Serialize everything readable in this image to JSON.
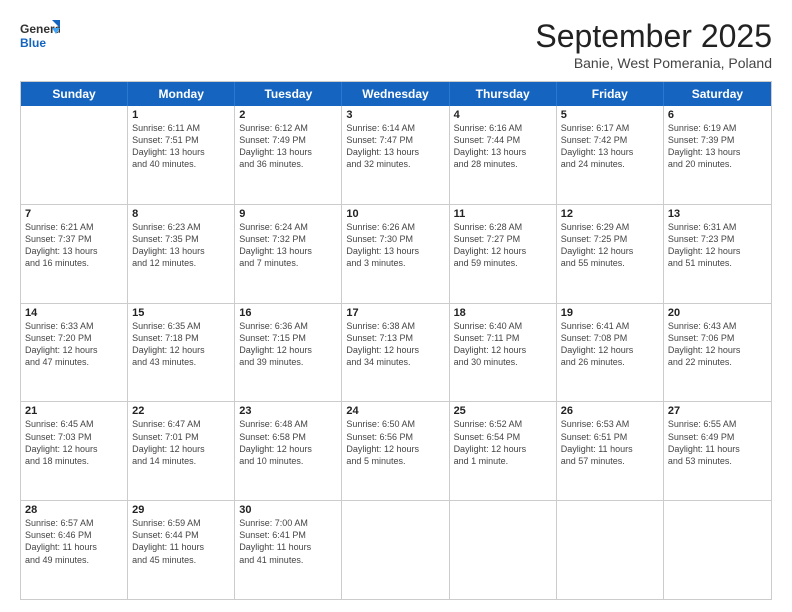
{
  "header": {
    "logo_general": "General",
    "logo_blue": "Blue",
    "month_title": "September 2025",
    "subtitle": "Banie, West Pomerania, Poland"
  },
  "days_of_week": [
    "Sunday",
    "Monday",
    "Tuesday",
    "Wednesday",
    "Thursday",
    "Friday",
    "Saturday"
  ],
  "weeks": [
    [
      {
        "day": "",
        "lines": []
      },
      {
        "day": "1",
        "lines": [
          "Sunrise: 6:11 AM",
          "Sunset: 7:51 PM",
          "Daylight: 13 hours",
          "and 40 minutes."
        ]
      },
      {
        "day": "2",
        "lines": [
          "Sunrise: 6:12 AM",
          "Sunset: 7:49 PM",
          "Daylight: 13 hours",
          "and 36 minutes."
        ]
      },
      {
        "day": "3",
        "lines": [
          "Sunrise: 6:14 AM",
          "Sunset: 7:47 PM",
          "Daylight: 13 hours",
          "and 32 minutes."
        ]
      },
      {
        "day": "4",
        "lines": [
          "Sunrise: 6:16 AM",
          "Sunset: 7:44 PM",
          "Daylight: 13 hours",
          "and 28 minutes."
        ]
      },
      {
        "day": "5",
        "lines": [
          "Sunrise: 6:17 AM",
          "Sunset: 7:42 PM",
          "Daylight: 13 hours",
          "and 24 minutes."
        ]
      },
      {
        "day": "6",
        "lines": [
          "Sunrise: 6:19 AM",
          "Sunset: 7:39 PM",
          "Daylight: 13 hours",
          "and 20 minutes."
        ]
      }
    ],
    [
      {
        "day": "7",
        "lines": [
          "Sunrise: 6:21 AM",
          "Sunset: 7:37 PM",
          "Daylight: 13 hours",
          "and 16 minutes."
        ]
      },
      {
        "day": "8",
        "lines": [
          "Sunrise: 6:23 AM",
          "Sunset: 7:35 PM",
          "Daylight: 13 hours",
          "and 12 minutes."
        ]
      },
      {
        "day": "9",
        "lines": [
          "Sunrise: 6:24 AM",
          "Sunset: 7:32 PM",
          "Daylight: 13 hours",
          "and 7 minutes."
        ]
      },
      {
        "day": "10",
        "lines": [
          "Sunrise: 6:26 AM",
          "Sunset: 7:30 PM",
          "Daylight: 13 hours",
          "and 3 minutes."
        ]
      },
      {
        "day": "11",
        "lines": [
          "Sunrise: 6:28 AM",
          "Sunset: 7:27 PM",
          "Daylight: 12 hours",
          "and 59 minutes."
        ]
      },
      {
        "day": "12",
        "lines": [
          "Sunrise: 6:29 AM",
          "Sunset: 7:25 PM",
          "Daylight: 12 hours",
          "and 55 minutes."
        ]
      },
      {
        "day": "13",
        "lines": [
          "Sunrise: 6:31 AM",
          "Sunset: 7:23 PM",
          "Daylight: 12 hours",
          "and 51 minutes."
        ]
      }
    ],
    [
      {
        "day": "14",
        "lines": [
          "Sunrise: 6:33 AM",
          "Sunset: 7:20 PM",
          "Daylight: 12 hours",
          "and 47 minutes."
        ]
      },
      {
        "day": "15",
        "lines": [
          "Sunrise: 6:35 AM",
          "Sunset: 7:18 PM",
          "Daylight: 12 hours",
          "and 43 minutes."
        ]
      },
      {
        "day": "16",
        "lines": [
          "Sunrise: 6:36 AM",
          "Sunset: 7:15 PM",
          "Daylight: 12 hours",
          "and 39 minutes."
        ]
      },
      {
        "day": "17",
        "lines": [
          "Sunrise: 6:38 AM",
          "Sunset: 7:13 PM",
          "Daylight: 12 hours",
          "and 34 minutes."
        ]
      },
      {
        "day": "18",
        "lines": [
          "Sunrise: 6:40 AM",
          "Sunset: 7:11 PM",
          "Daylight: 12 hours",
          "and 30 minutes."
        ]
      },
      {
        "day": "19",
        "lines": [
          "Sunrise: 6:41 AM",
          "Sunset: 7:08 PM",
          "Daylight: 12 hours",
          "and 26 minutes."
        ]
      },
      {
        "day": "20",
        "lines": [
          "Sunrise: 6:43 AM",
          "Sunset: 7:06 PM",
          "Daylight: 12 hours",
          "and 22 minutes."
        ]
      }
    ],
    [
      {
        "day": "21",
        "lines": [
          "Sunrise: 6:45 AM",
          "Sunset: 7:03 PM",
          "Daylight: 12 hours",
          "and 18 minutes."
        ]
      },
      {
        "day": "22",
        "lines": [
          "Sunrise: 6:47 AM",
          "Sunset: 7:01 PM",
          "Daylight: 12 hours",
          "and 14 minutes."
        ]
      },
      {
        "day": "23",
        "lines": [
          "Sunrise: 6:48 AM",
          "Sunset: 6:58 PM",
          "Daylight: 12 hours",
          "and 10 minutes."
        ]
      },
      {
        "day": "24",
        "lines": [
          "Sunrise: 6:50 AM",
          "Sunset: 6:56 PM",
          "Daylight: 12 hours",
          "and 5 minutes."
        ]
      },
      {
        "day": "25",
        "lines": [
          "Sunrise: 6:52 AM",
          "Sunset: 6:54 PM",
          "Daylight: 12 hours",
          "and 1 minute."
        ]
      },
      {
        "day": "26",
        "lines": [
          "Sunrise: 6:53 AM",
          "Sunset: 6:51 PM",
          "Daylight: 11 hours",
          "and 57 minutes."
        ]
      },
      {
        "day": "27",
        "lines": [
          "Sunrise: 6:55 AM",
          "Sunset: 6:49 PM",
          "Daylight: 11 hours",
          "and 53 minutes."
        ]
      }
    ],
    [
      {
        "day": "28",
        "lines": [
          "Sunrise: 6:57 AM",
          "Sunset: 6:46 PM",
          "Daylight: 11 hours",
          "and 49 minutes."
        ]
      },
      {
        "day": "29",
        "lines": [
          "Sunrise: 6:59 AM",
          "Sunset: 6:44 PM",
          "Daylight: 11 hours",
          "and 45 minutes."
        ]
      },
      {
        "day": "30",
        "lines": [
          "Sunrise: 7:00 AM",
          "Sunset: 6:41 PM",
          "Daylight: 11 hours",
          "and 41 minutes."
        ]
      },
      {
        "day": "",
        "lines": []
      },
      {
        "day": "",
        "lines": []
      },
      {
        "day": "",
        "lines": []
      },
      {
        "day": "",
        "lines": []
      }
    ]
  ]
}
